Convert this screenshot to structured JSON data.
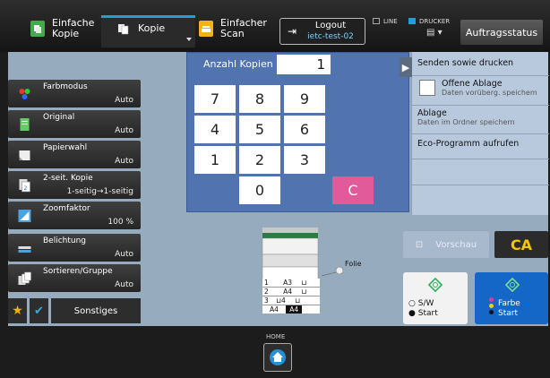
{
  "topbar": {
    "tabs": [
      {
        "label_line1": "Einfache",
        "label_line2": "Kopie"
      },
      {
        "label_line1": "Kopie"
      },
      {
        "label_line1": "Einfacher",
        "label_line2": "Scan"
      }
    ],
    "logout": {
      "label": "Logout",
      "user": "ietc-test-02"
    },
    "status_line": "LINE",
    "status_drucker": "DRUCKER",
    "job_status_label": "Auftragsstatus",
    "colors": {
      "accent": "#1e9fd8",
      "panel": "#97abbf"
    }
  },
  "sidebar": {
    "items": [
      {
        "label": "Farbmodus",
        "value": "Auto",
        "icon": "color-mode-icon"
      },
      {
        "label": "Original",
        "value": "Auto",
        "icon": "original-icon"
      },
      {
        "label": "Papierwahl",
        "value": "Auto",
        "icon": "paper-icon"
      },
      {
        "label": "2-seit. Kopie",
        "value": "1-seitig→1-seitig",
        "icon": "duplex-icon"
      },
      {
        "label": "Zoomfaktor",
        "value": "100 %",
        "icon": "zoom-icon"
      },
      {
        "label": "Belichtung",
        "value": "Auto",
        "icon": "exposure-icon"
      },
      {
        "label": "Sortieren/Gruppe",
        "value": "Auto",
        "icon": "sort-icon"
      }
    ],
    "others_label": "Sonstiges"
  },
  "keypad": {
    "label": "Anzahl Kopien",
    "value": "1",
    "keys": [
      "7",
      "8",
      "9",
      "4",
      "5",
      "6",
      "1",
      "2",
      "3",
      "0"
    ],
    "clear": "C"
  },
  "right_panel": {
    "send_print": "Senden sowie drucken",
    "open_tray": "Offene Ablage",
    "open_tray_sub": "Daten vorüberg. speichem",
    "store": "Ablage",
    "store_sub": "Daten im Ordner speichern",
    "eco": "Eco-Programm aufrufen"
  },
  "machine": {
    "label": "Folie",
    "trays": [
      {
        "num": "1",
        "size": "A3"
      },
      {
        "num": "2",
        "size": "A4"
      },
      {
        "num": "3",
        "size": "",
        "size2": "4"
      },
      {
        "num": "",
        "size": "A4",
        "size2": "A4"
      }
    ]
  },
  "actions": {
    "preview": "Vorschau",
    "ca": "CA",
    "bw_label": "S/W",
    "bw_start": "Start",
    "color_label": "Farbe",
    "color_start": "Start"
  },
  "bottom": {
    "home_label": "HOME"
  }
}
